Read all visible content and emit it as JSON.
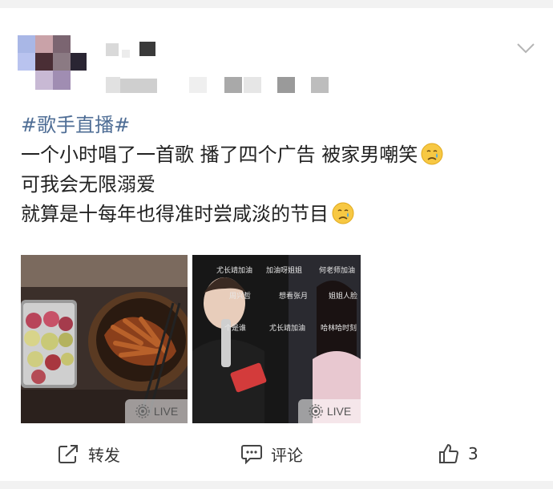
{
  "post": {
    "hashtag": "#歌手直播#",
    "lines": [
      "一个小时唱了一首歌 播了四个广告 被家男嘲笑",
      "可我会无限溺爱",
      "就算是十每年也得准时尝咸淡的节目"
    ],
    "emoji": "crying-face-icon"
  },
  "images": [
    {
      "badge": "LIVE",
      "subject": "food"
    },
    {
      "badge": "LIVE",
      "subject": "stage"
    }
  ],
  "danmaku": [
    "尤长靖加油",
    "加油呀姐姐",
    "何老师加油",
    "周兴哲",
    "想看张月",
    "姐姐人脸",
    "个是谁",
    "尤长靖加油",
    "哈林哈时刻"
  ],
  "actions": {
    "repost_label": "转发",
    "comment_label": "评论",
    "like_count": "3"
  },
  "colors": {
    "hashtag": "#4e6d95",
    "text": "#222222",
    "background": "#f2f2f2"
  }
}
